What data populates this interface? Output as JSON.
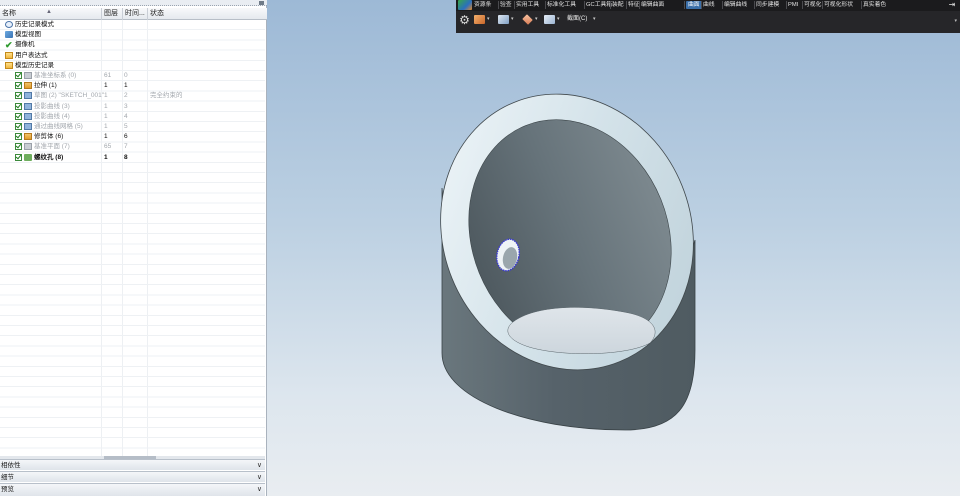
{
  "navigator": {
    "columns": {
      "name": "名称",
      "layer": "图层",
      "time": "时间...",
      "status": "状态"
    },
    "rows": [
      {
        "name": "历史记录模式",
        "layer": "",
        "time": "",
        "status": "",
        "icon": "history-mode-icon",
        "style": "normal",
        "checked": false
      },
      {
        "name": "模型视图",
        "layer": "",
        "time": "",
        "status": "",
        "icon": "model-views-icon",
        "style": "normal",
        "checked": false
      },
      {
        "name": "摄像机",
        "layer": "",
        "time": "",
        "status": "",
        "icon": "camera-icon",
        "style": "normal",
        "checked": false
      },
      {
        "name": "用户表达式",
        "layer": "",
        "time": "",
        "status": "",
        "icon": "expressions-folder-icon",
        "style": "normal",
        "checked": false
      },
      {
        "name": "模型历史记录",
        "layer": "",
        "time": "",
        "status": "",
        "icon": "history-folder-icon",
        "style": "normal",
        "checked": false
      },
      {
        "name": "基准坐标系 (0)",
        "layer": "61",
        "time": "0",
        "status": "",
        "icon": "datum-csys-icon",
        "style": "grey",
        "checked": true
      },
      {
        "name": "拉伸 (1)",
        "layer": "1",
        "time": "1",
        "status": "",
        "icon": "extrude-icon",
        "style": "normal",
        "checked": true
      },
      {
        "name": "草图 (2) \"SKETCH_001\"",
        "layer": "1",
        "time": "2",
        "status": "完全约束的",
        "icon": "sketch-icon",
        "style": "grey",
        "checked": true
      },
      {
        "name": "投影曲线 (3)",
        "layer": "1",
        "time": "3",
        "status": "",
        "icon": "project-curve-icon",
        "style": "grey",
        "checked": true
      },
      {
        "name": "投影曲线 (4)",
        "layer": "1",
        "time": "4",
        "status": "",
        "icon": "project-curve-icon",
        "style": "grey",
        "checked": true
      },
      {
        "name": "通过曲线网格 (5)",
        "layer": "1",
        "time": "5",
        "status": "",
        "icon": "curve-mesh-icon",
        "style": "grey",
        "checked": true
      },
      {
        "name": "修剪体 (6)",
        "layer": "1",
        "time": "6",
        "status": "",
        "icon": "trim-body-icon",
        "style": "normal",
        "checked": true
      },
      {
        "name": "基准平面 (7)",
        "layer": "65",
        "time": "7",
        "status": "",
        "icon": "datum-plane-icon",
        "style": "grey",
        "checked": true
      },
      {
        "name": "螺纹孔 (8)",
        "layer": "1",
        "time": "8",
        "status": "",
        "icon": "threaded-hole-icon",
        "style": "bold",
        "checked": true
      }
    ],
    "panels": [
      "相依性",
      "细节",
      "预览"
    ]
  },
  "ribbon": {
    "tabs": [
      "资源条",
      "验查",
      "实用工具",
      "标准化工具",
      "GC工具箱",
      "装配",
      "特征",
      "编辑曲面",
      "曲面",
      "曲线",
      "编辑曲线",
      "同步建模",
      "PMI",
      "可视化",
      "可视化形状",
      "真实着色"
    ],
    "active_tab": "曲面",
    "section_label": "截面(C)",
    "tools": [
      "snap-point-icon",
      "view-orient-icon",
      "render-style-icon",
      "section-view-icon"
    ]
  },
  "colors": {
    "ribbon_bg": "#1b1b1d",
    "active_tab": "#3b6fa8",
    "model_body": "#5f6a6f",
    "model_face": "#d6e4ea",
    "hole_highlight": "#3a3ad0"
  }
}
